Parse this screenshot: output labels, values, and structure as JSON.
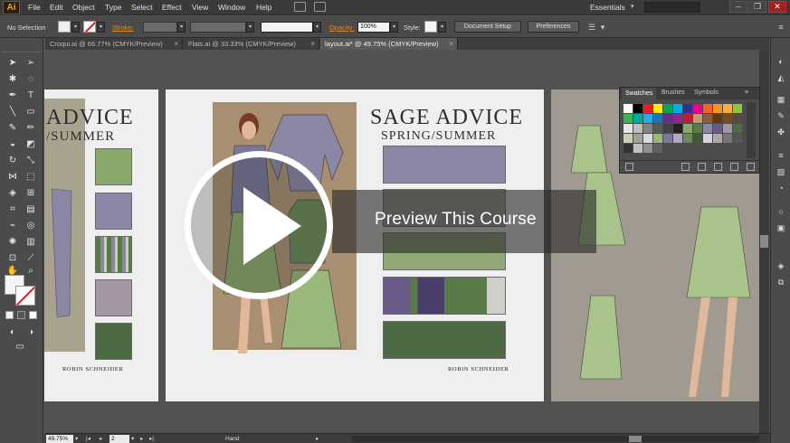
{
  "app": {
    "logo_text": "Ai",
    "menus": [
      "File",
      "Edit",
      "Object",
      "Type",
      "Select",
      "Effect",
      "View",
      "Window",
      "Help"
    ],
    "workspace": "Essentials"
  },
  "control_bar": {
    "selection_status": "No Selection",
    "stroke_label": "Stroke:",
    "opacity_label": "Opacity:",
    "opacity_value": "100%",
    "style_label": "Style:",
    "document_setup": "Document Setup",
    "preferences": "Preferences"
  },
  "tabs": [
    {
      "label": "Croqui.ai @ 66.77% (CMYK/Preview)",
      "active": false
    },
    {
      "label": "Flats.ai @ 33.33% (CMYK/Preview)",
      "active": false
    },
    {
      "label": "layout.ai* @ 49.75% (CMYK/Preview)",
      "active": true
    }
  ],
  "artboards": {
    "left": {
      "title_line1": "ADVICE",
      "title_line2": "/SUMMER",
      "author": "ROBIN SCHNEIDER"
    },
    "center": {
      "title_line1": "SAGE ADVICE",
      "title_line2": "SPRING/SUMMER",
      "author": "ROBIN SCHNEIDER"
    }
  },
  "swatches_panel": {
    "tabs": [
      "Swatches",
      "Brushes",
      "Symbols"
    ],
    "active_tab": "Swatches"
  },
  "status_bar": {
    "zoom": "49.75%",
    "artboard_number": "2",
    "current_tool": "Hand"
  },
  "overlay": {
    "preview_text": "Preview This Course"
  },
  "colors": {
    "sage_green": "#5a7a4a",
    "lavender": "#8a86a4",
    "panel_bg": "#4b4b4b",
    "overlay_white": "#ffffff"
  }
}
